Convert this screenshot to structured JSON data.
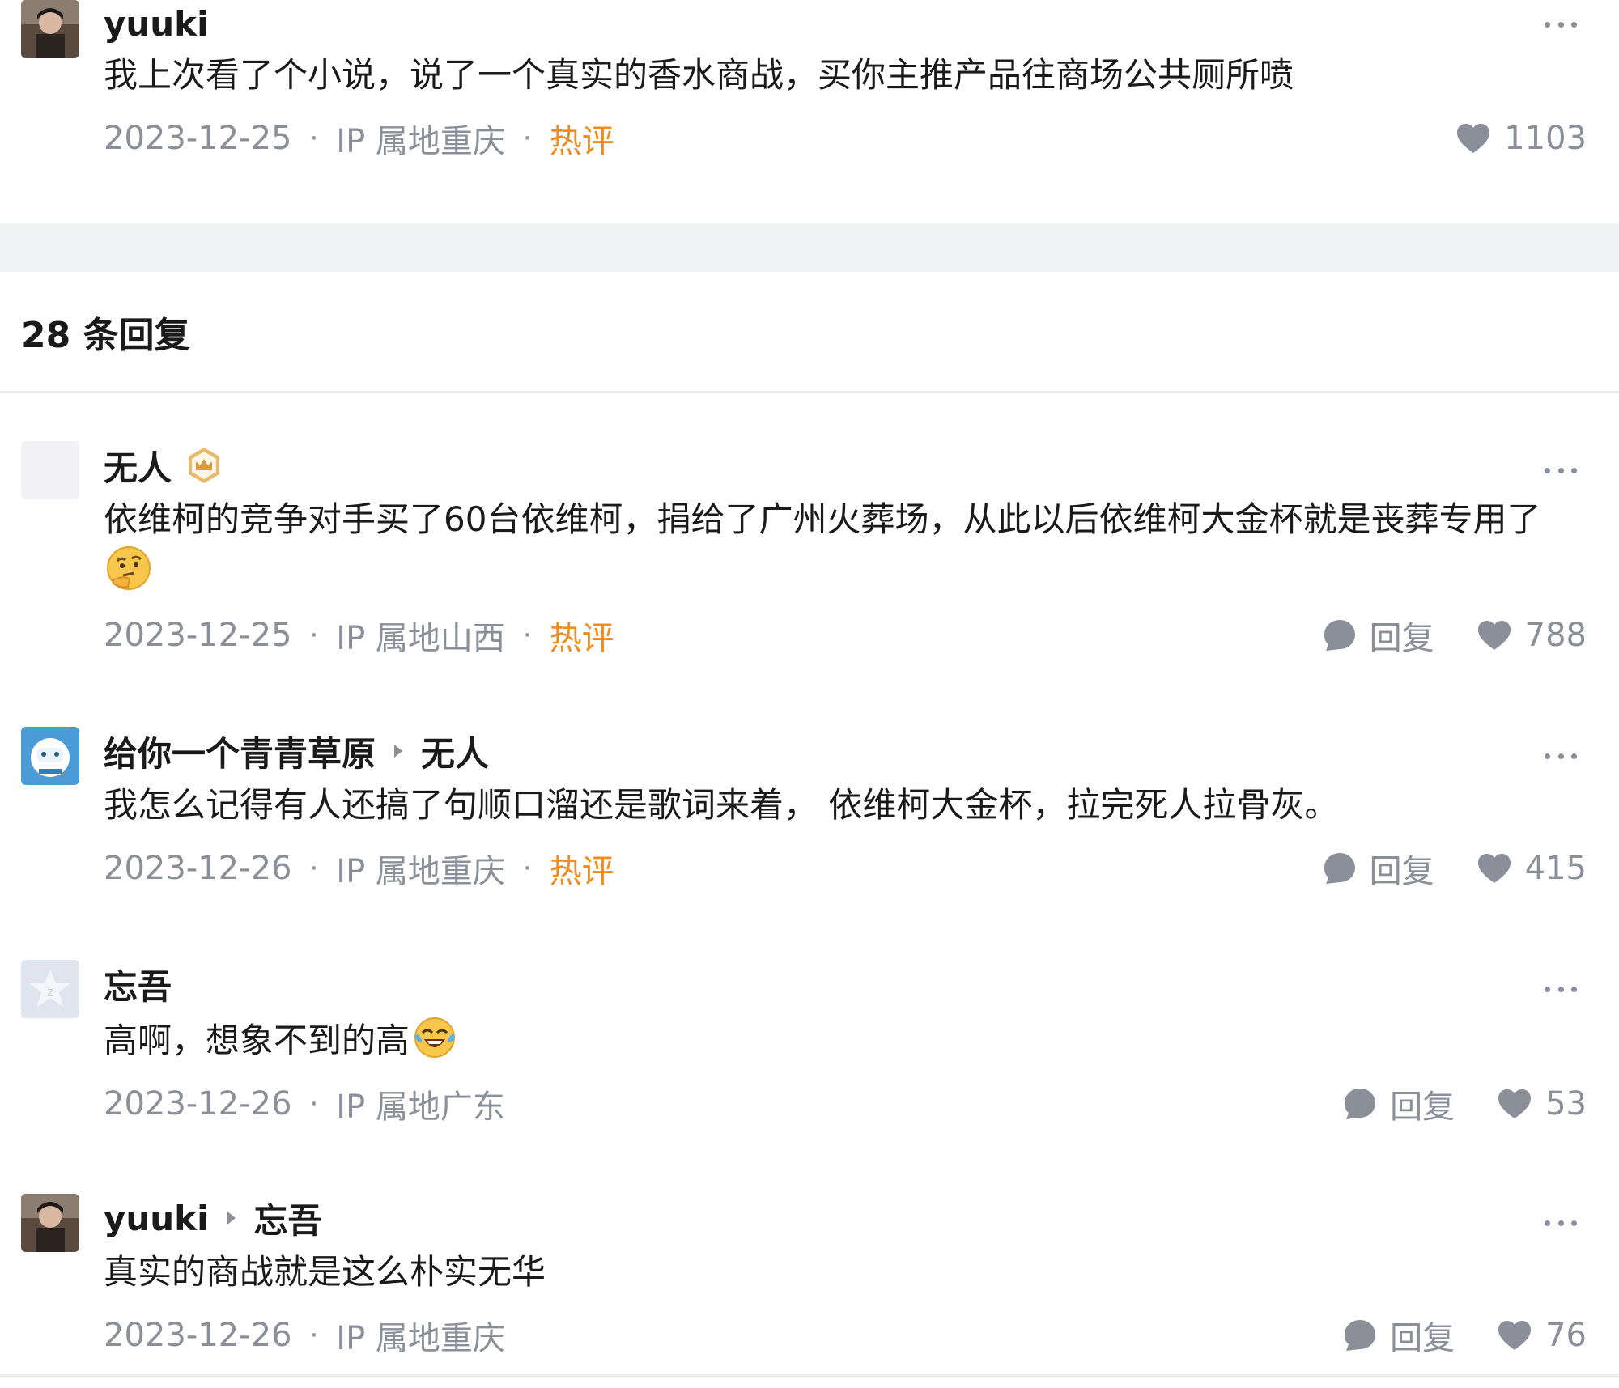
{
  "top_comment": {
    "user": "yuuki",
    "content": "我上次看了个小说，说了一个真实的香水商战，买你主推产品往商场公共厕所喷",
    "date": "2023-12-25",
    "ip": "IP 属地重庆",
    "hot": "热评",
    "likes": "1103"
  },
  "replies_header": "28 条回复",
  "replies": [
    {
      "user": "无人",
      "badge": "crown-badge",
      "content": "依维柯的竞争对手买了60台依维柯，捐给了广州火葬场，从此以后依维柯大金杯就是丧葬专用了",
      "emoji": "thinking-face",
      "date": "2023-12-25",
      "ip": "IP 属地山西",
      "hot": "热评",
      "reply_label": "回复",
      "likes": "788"
    },
    {
      "user": "给你一个青青草原",
      "reply_to": "无人",
      "content": "我怎么记得有人还搞了句顺口溜还是歌词来着， 依维柯大金杯，拉完死人拉骨灰。",
      "date": "2023-12-26",
      "ip": "IP 属地重庆",
      "hot": "热评",
      "reply_label": "回复",
      "likes": "415"
    },
    {
      "user": "忘吾",
      "content": "高啊，想象不到的高",
      "emoji": "tears-of-joy",
      "date": "2023-12-26",
      "ip": "IP 属地广东",
      "reply_label": "回复",
      "likes": "53"
    },
    {
      "user": "yuuki",
      "reply_to": "忘吾",
      "content": "真实的商战就是这么朴实无华",
      "date": "2023-12-26",
      "ip": "IP 属地重庆",
      "reply_label": "回复",
      "likes": "76"
    }
  ],
  "colors": {
    "meta": "#8a8f99",
    "hot": "#f08c1e",
    "band": "#f1f2f4"
  }
}
